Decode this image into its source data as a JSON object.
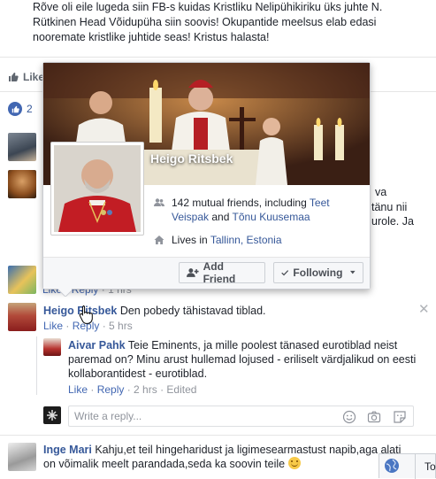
{
  "post": {
    "text": "Rõve oli eile lugeda siin FB-s kuidas Kristliku Nelipühikiriku üks juhte N. Rütkinen Head Võidupüha siin soovis! Okupantide meelsus elab edasi nooremate kristlike juhtide seas! Kristus halasta!",
    "like_label": "Like",
    "like_count": "2"
  },
  "partial_texts": {
    "right_1": "va",
    "right_2": "tänu nii",
    "right_3": "urole. Ja"
  },
  "hovercard": {
    "name": "Heigo Ritsbek",
    "mutual_prefix": "142 mutual friends, including ",
    "mutual_friend_1": "Teet Veispak",
    "mutual_and": " and ",
    "mutual_friend_2": "Tõnu Kuusemaa",
    "lives_prefix": "Lives in ",
    "location": "Tallinn, Estonia",
    "add_friend_label": "Add Friend",
    "following_label": "Following"
  },
  "hidden_comment_meta": {
    "like": "Like",
    "reply": "Reply",
    "time": "1 hrs"
  },
  "comments": [
    {
      "name": "Heigo Ritsbek",
      "text": " Den pobedy tähistavad tiblad.",
      "like": "Like",
      "reply": "Reply",
      "time": "5 hrs",
      "sep": " · "
    },
    {
      "name": "Aivar Pahk",
      "text": " Teie Eminents, ja mille poolest tänased eurotiblad neist paremad on? Minu arust hullemad lojused - eriliselt värdjalikud on eesti kollaborantidest - eurotiblad.",
      "like": "Like",
      "reply": "Reply",
      "time": "2 hrs",
      "edited": "Edited",
      "sep": " · "
    },
    {
      "name": "Inge Mari",
      "text": " Kahju,et teil hingeharidust ja ligimesearmastust napib,aga alati on võimalik meelt parandada,seda ka soovin teile"
    }
  ],
  "reply_box": {
    "placeholder": "Write a reply..."
  },
  "chat": {
    "label": "To"
  },
  "colors": {
    "link": "#365899",
    "meta": "#90949c",
    "like_blue": "#4267b2"
  }
}
